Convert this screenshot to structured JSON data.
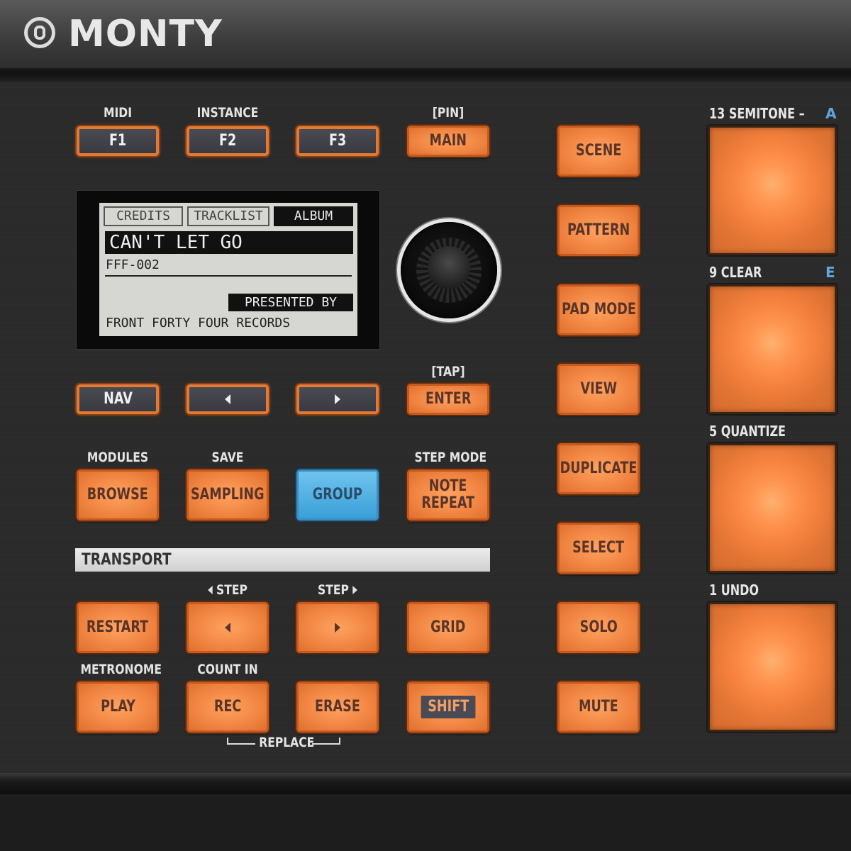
{
  "header": {
    "brand": "MONTY"
  },
  "function_row": {
    "labels": [
      "MIDI",
      "INSTANCE",
      "",
      "[PIN]"
    ],
    "buttons": [
      "F1",
      "F2",
      "F3",
      "MAIN"
    ]
  },
  "display": {
    "tabs": [
      "CREDITS",
      "TRACKLIST",
      "ALBUM"
    ],
    "active_tab": "ALBUM",
    "title": "CAN'T LET GO",
    "catalog": "FFF-002",
    "presented_label": "PRESENTED BY",
    "label_name": "FRONT FORTY FOUR RECORDS"
  },
  "nav_row": {
    "tap_label": "[TAP]",
    "nav": "NAV",
    "enter": "ENTER"
  },
  "mode_row": {
    "labels": [
      "MODULES",
      "SAVE",
      "",
      "STEP MODE"
    ],
    "browse": "BROWSE",
    "sampling": "SAMPLING",
    "group": "GROUP",
    "note_repeat_1": "NOTE",
    "note_repeat_2": "REPEAT"
  },
  "transport": {
    "header": "TRANSPORT",
    "step_left_label": "STEP",
    "step_right_label": "STEP",
    "restart": "RESTART",
    "grid": "GRID",
    "metronome_label": "METRONOME",
    "count_in_label": "COUNT IN",
    "play": "PLAY",
    "rec": "REC",
    "erase": "ERASE",
    "shift": "SHIFT",
    "replace_label": "REPLACE"
  },
  "side_column": [
    "SCENE",
    "PATTERN",
    "PAD MODE",
    "VIEW",
    "DUPLICATE",
    "SELECT",
    "SOLO",
    "MUTE"
  ],
  "pads": [
    {
      "label": "13 SEMITONE –",
      "letter": "A"
    },
    {
      "label": "9 CLEAR",
      "letter": "E"
    },
    {
      "label": "5 QUANTIZE",
      "letter": ""
    },
    {
      "label": "1 UNDO",
      "letter": ""
    }
  ],
  "colors": {
    "accent_orange": "#f28744",
    "group_blue": "#3a9fd8",
    "pad_letter_blue": "#5fa6e0"
  }
}
